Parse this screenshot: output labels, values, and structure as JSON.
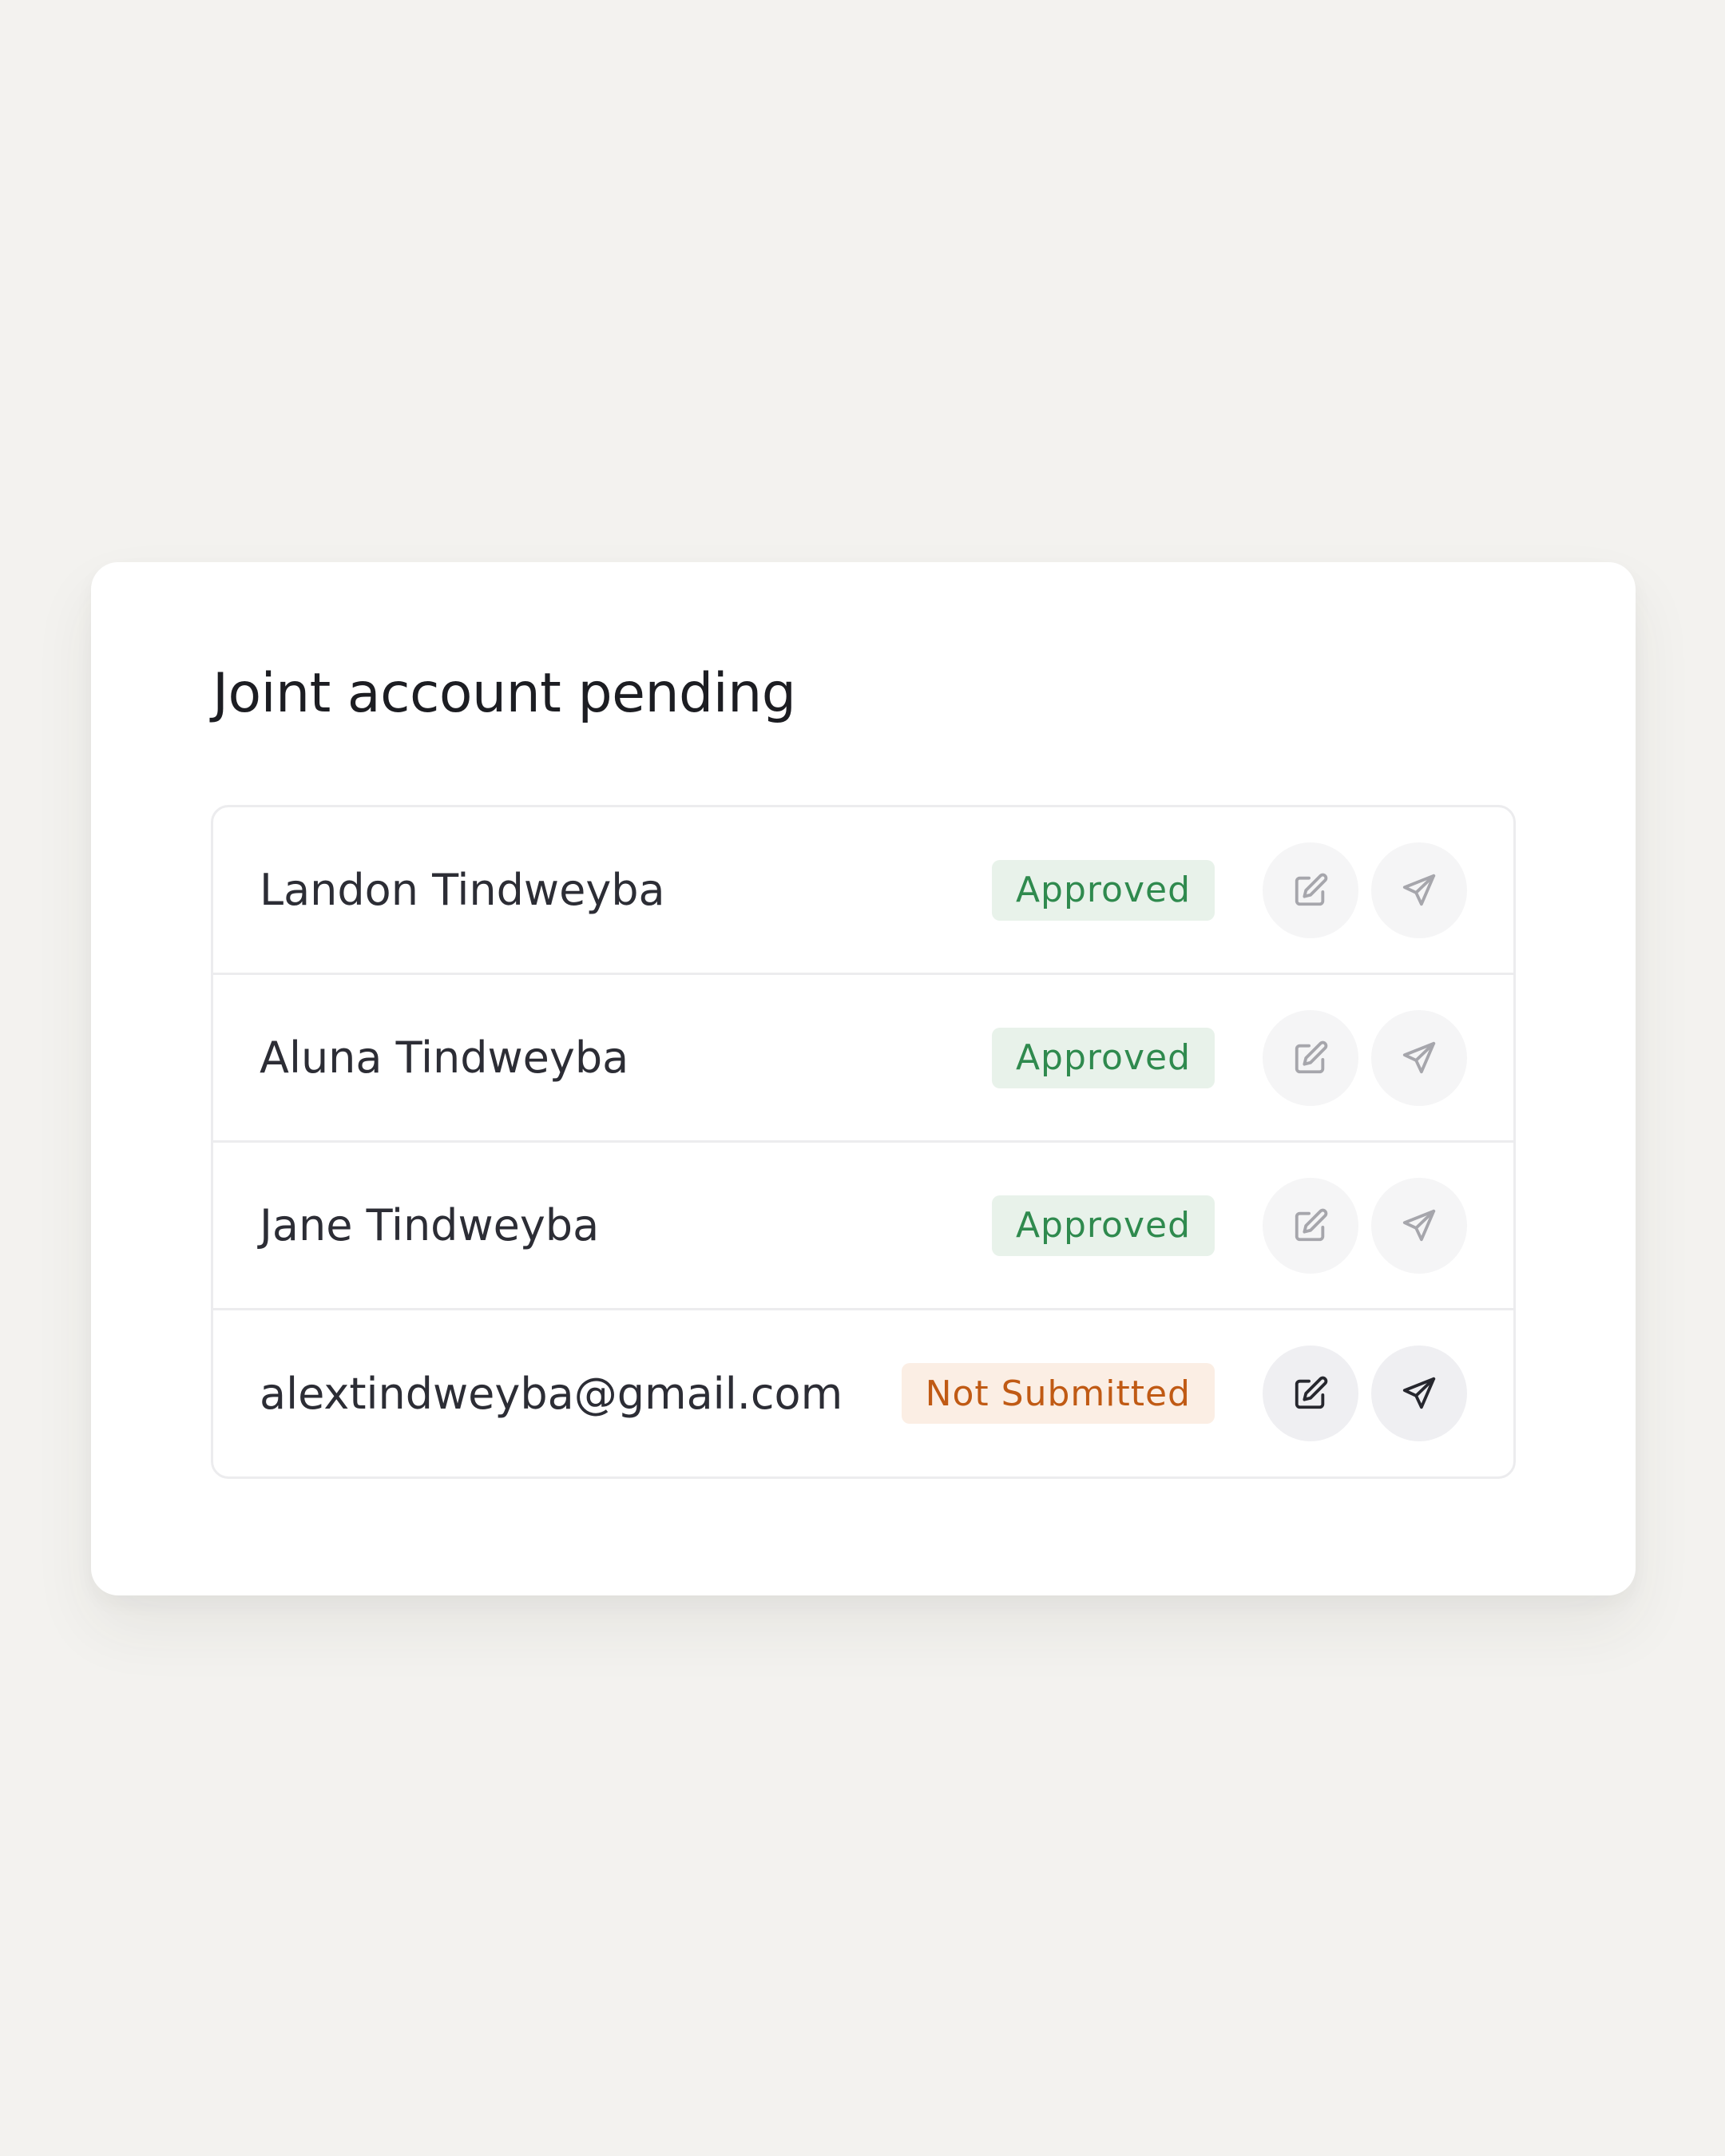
{
  "card": {
    "title": "Joint account pending"
  },
  "members": [
    {
      "name": "Landon Tindweyba",
      "status": "Approved",
      "status_type": "approved",
      "edit_icon": "edit-icon",
      "send_icon": "send-icon",
      "actions_enabled": false
    },
    {
      "name": "Aluna Tindweyba",
      "status": "Approved",
      "status_type": "approved",
      "edit_icon": "edit-icon",
      "send_icon": "send-icon",
      "actions_enabled": false
    },
    {
      "name": "Jane Tindweyba",
      "status": "Approved",
      "status_type": "approved",
      "edit_icon": "edit-icon",
      "send_icon": "send-icon",
      "actions_enabled": false
    },
    {
      "name": "alextindweyba@gmail.com",
      "status": "Not Submitted",
      "status_type": "not-submitted",
      "edit_icon": "edit-icon",
      "send_icon": "send-icon",
      "actions_enabled": true
    }
  ],
  "colors": {
    "background": "#f3f2ef",
    "card": "#ffffff",
    "approved_bg": "#e8f2ea",
    "approved_text": "#2f8a4e",
    "not_submitted_bg": "#fbeee4",
    "not_submitted_text": "#c05a14",
    "icon_inactive": "#a6a6ac",
    "icon_active": "#26272e"
  }
}
